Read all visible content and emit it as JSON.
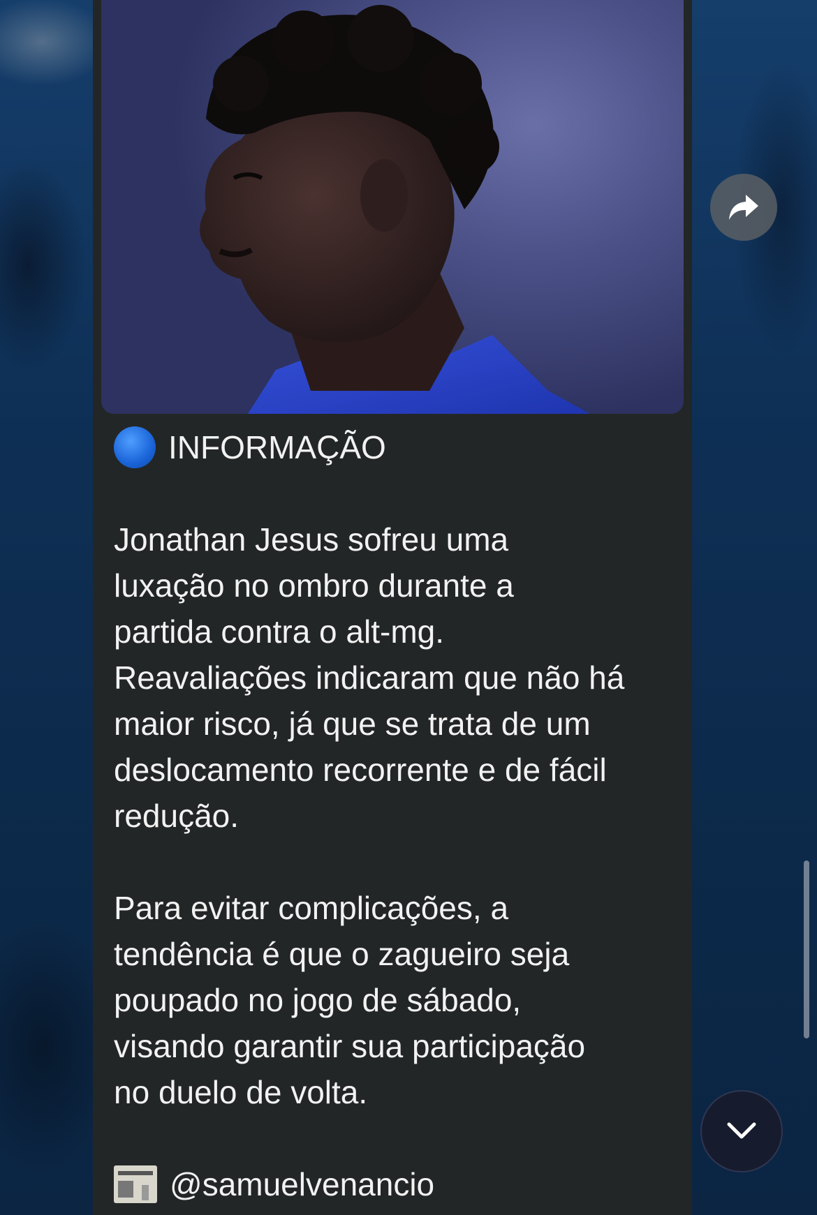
{
  "message": {
    "header_label": "INFORMAÇÃO",
    "header_icon": "blue-circle-emoji",
    "paragraph1_lines": [
      "Jonathan Jesus sofreu uma",
      "luxação no ombro durante a",
      "partida contra o alt-mg.",
      "Reavaliações indicaram que não há",
      "maior risco, já que se trata de um",
      "deslocamento recorrente e de fácil",
      "redução."
    ],
    "paragraph2_lines": [
      "Para evitar complicações, a",
      "tendência é que o zagueiro seja",
      "poupado no jogo de sábado,",
      "visando garantir sua participação",
      "no duelo de volta."
    ],
    "source_icon": "newspaper-emoji",
    "source_handle": "@samuelvenancio"
  },
  "colors": {
    "bubble_bg": "#232626",
    "text": "#f2f2f2",
    "wallpaper": "#0d2a4c"
  },
  "icons": {
    "share": "share-arrow-icon",
    "scroll_down": "chevron-down-icon"
  }
}
